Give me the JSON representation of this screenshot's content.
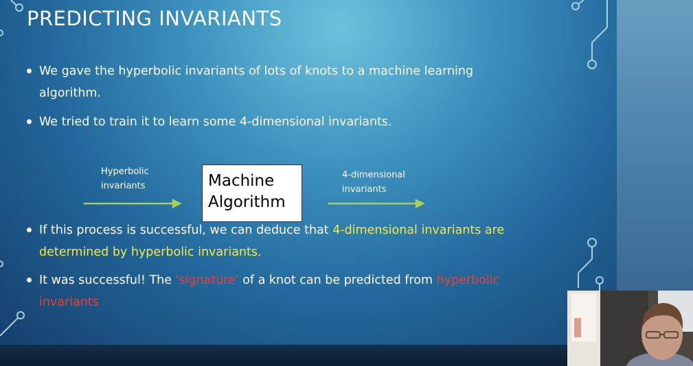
{
  "slide": {
    "title": "PREDICTING INVARIANTS",
    "bullets": [
      {
        "lines": [
          "We gave the hyperbolic invariants of lots of knots to a machine learning",
          "algorithm."
        ]
      },
      {
        "lines": [
          "We tried to train it to learn some 4-dimensional invariants."
        ]
      },
      {
        "text_before": "If this process is successful, we can deduce that ",
        "highlight_1": "4-dimensional invariants are",
        "highlight_2": "determined by hyperbolic invariants."
      },
      {
        "text_before": "It was successful! The ",
        "highlight_sig": "'signature'",
        "text_mid": " of a knot can be predicted from ",
        "highlight_hyp_1": "hyperbolic",
        "highlight_hyp_2": "invariants"
      }
    ],
    "diagram": {
      "input_label_line1": "Hyperbolic",
      "input_label_line2": "invariants",
      "box_line1": "Machine",
      "box_line2": "Algorithm",
      "output_label_line1": "4-dimensional",
      "output_label_line2": "invariants"
    }
  },
  "colors": {
    "highlight_yellow": "#f2e94a",
    "highlight_red": "#e8413a",
    "arrow_green": "#a6cf5c"
  },
  "webcam": {
    "present": true
  }
}
